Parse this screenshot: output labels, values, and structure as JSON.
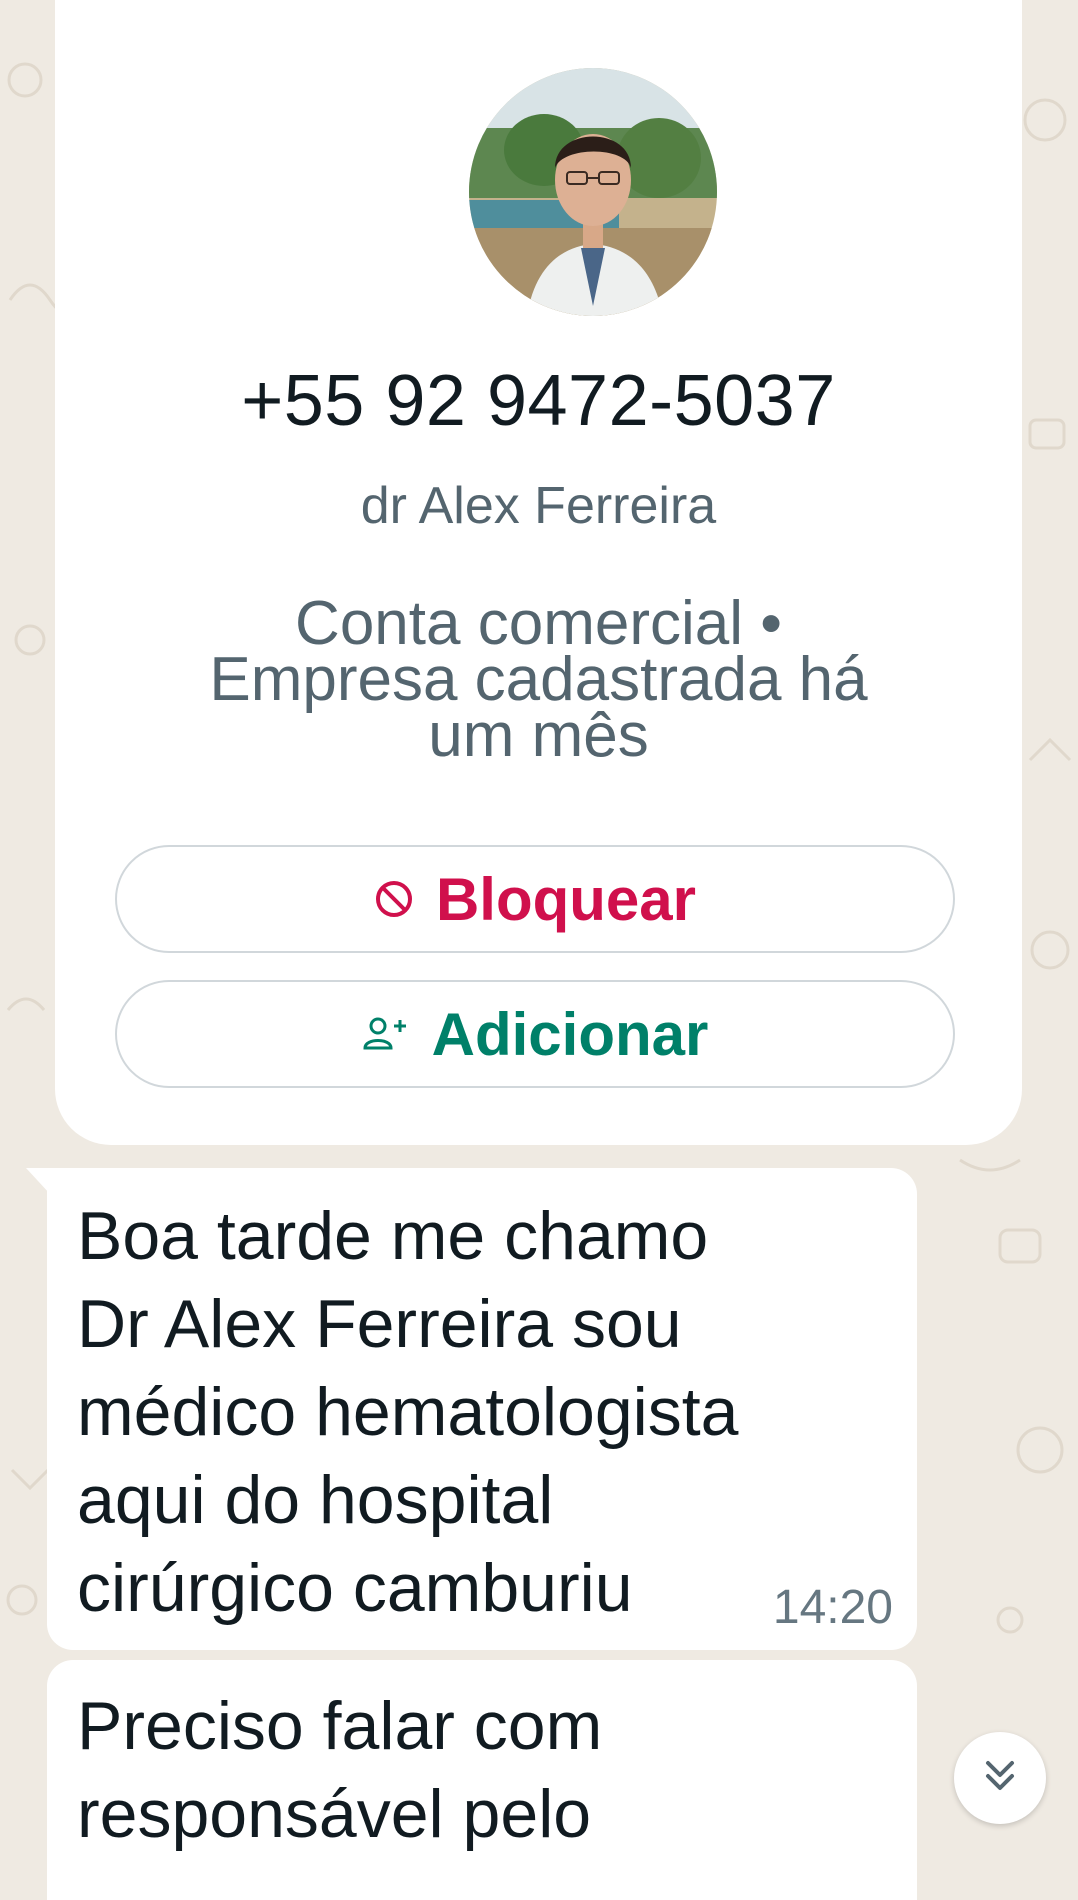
{
  "contact_card": {
    "phone": "+55 92 9472-5037",
    "name": "dr Alex Ferreira",
    "account_info": "Conta comercial • Empresa cadastrada há um mês",
    "block_label": "Bloquear",
    "add_label": "Adicionar"
  },
  "messages": [
    {
      "text": "Boa tarde me chamo\nDr Alex Ferreira sou\nmédico hematologista\naqui do hospital\ncirúrgico camburiu",
      "time": "14:20"
    },
    {
      "text": "Preciso falar com\nresponsável pelo"
    }
  ],
  "colors": {
    "background": "#efeae2",
    "bubble": "#ffffff",
    "block_red": "#d0104c",
    "add_green": "#008069",
    "secondary_text": "#54656f",
    "time_text": "#667781"
  },
  "icons": {
    "block": "block-icon",
    "add_contact": "add-contact-icon",
    "scroll_down": "chevron-double-down-icon"
  }
}
